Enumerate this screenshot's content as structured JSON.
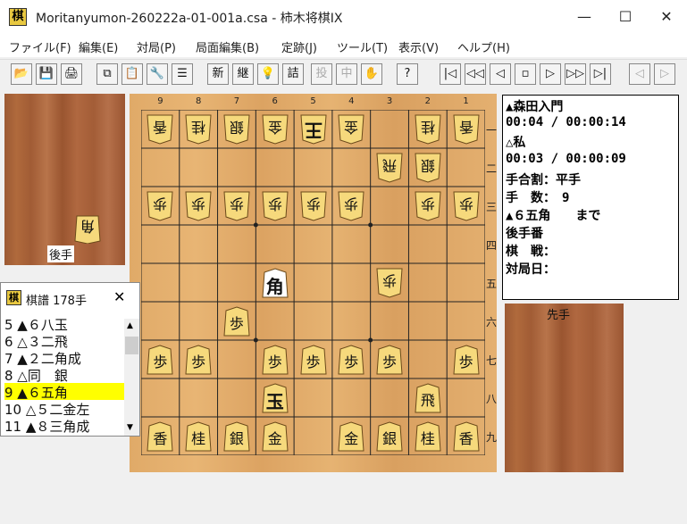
{
  "window": {
    "title": "Moritanyumon-260222a-01-001a.csa - 柿木将棋IX",
    "app_icon": "棋",
    "minimize": "—",
    "maximize": "☐",
    "close": "✕"
  },
  "menu": [
    "ファイル(F)",
    "編集(E)",
    "対局(P)",
    "局面編集(B)",
    "定跡(J)",
    "ツール(T)",
    "表示(V)",
    "ヘルプ(H)"
  ],
  "toolbar": {
    "open": "📂",
    "save": "💾",
    "print": "🖨",
    "copy": "⧉",
    "paste": "📋",
    "settings": "🔧",
    "list": "☰",
    "new_game": "新",
    "continue": "継",
    "hint": "💡",
    "tsume": "詰",
    "resign": "投",
    "pause": "中",
    "hand": "✋",
    "help": "?",
    "first": "|◁",
    "back_fast": "◁◁",
    "back": "◁",
    "stop": "▫",
    "forward": "▷",
    "forward_fast": "▷▷",
    "last": "▷|",
    "branch_prev": "◁",
    "branch_next": "▷"
  },
  "board": {
    "cols": [
      "9",
      "8",
      "7",
      "6",
      "5",
      "4",
      "3",
      "2",
      "1"
    ],
    "rows": [
      "一",
      "二",
      "三",
      "四",
      "五",
      "六",
      "七",
      "八",
      "九"
    ],
    "pieces": [
      {
        "c": 0,
        "r": 0,
        "ch": "香",
        "side": "gote"
      },
      {
        "c": 1,
        "r": 0,
        "ch": "桂",
        "side": "gote"
      },
      {
        "c": 2,
        "r": 0,
        "ch": "銀",
        "side": "gote"
      },
      {
        "c": 3,
        "r": 0,
        "ch": "金",
        "side": "gote"
      },
      {
        "c": 4,
        "r": 0,
        "ch": "王",
        "side": "gote",
        "big": true
      },
      {
        "c": 5,
        "r": 0,
        "ch": "金",
        "side": "gote"
      },
      {
        "c": 7,
        "r": 0,
        "ch": "桂",
        "side": "gote"
      },
      {
        "c": 8,
        "r": 0,
        "ch": "香",
        "side": "gote"
      },
      {
        "c": 6,
        "r": 1,
        "ch": "飛",
        "side": "gote"
      },
      {
        "c": 7,
        "r": 1,
        "ch": "銀",
        "side": "gote"
      },
      {
        "c": 0,
        "r": 2,
        "ch": "歩",
        "side": "gote"
      },
      {
        "c": 1,
        "r": 2,
        "ch": "歩",
        "side": "gote"
      },
      {
        "c": 2,
        "r": 2,
        "ch": "歩",
        "side": "gote"
      },
      {
        "c": 3,
        "r": 2,
        "ch": "歩",
        "side": "gote"
      },
      {
        "c": 4,
        "r": 2,
        "ch": "歩",
        "side": "gote"
      },
      {
        "c": 5,
        "r": 2,
        "ch": "歩",
        "side": "gote"
      },
      {
        "c": 7,
        "r": 2,
        "ch": "歩",
        "side": "gote"
      },
      {
        "c": 8,
        "r": 2,
        "ch": "歩",
        "side": "gote"
      },
      {
        "c": 3,
        "r": 4,
        "ch": "角",
        "side": "sente",
        "big": true,
        "highlight": true
      },
      {
        "c": 6,
        "r": 4,
        "ch": "歩",
        "side": "gote"
      },
      {
        "c": 2,
        "r": 5,
        "ch": "歩",
        "side": "sente"
      },
      {
        "c": 0,
        "r": 6,
        "ch": "歩",
        "side": "sente"
      },
      {
        "c": 1,
        "r": 6,
        "ch": "歩",
        "side": "sente"
      },
      {
        "c": 3,
        "r": 6,
        "ch": "歩",
        "side": "sente"
      },
      {
        "c": 4,
        "r": 6,
        "ch": "歩",
        "side": "sente"
      },
      {
        "c": 5,
        "r": 6,
        "ch": "歩",
        "side": "sente"
      },
      {
        "c": 6,
        "r": 6,
        "ch": "歩",
        "side": "sente"
      },
      {
        "c": 8,
        "r": 6,
        "ch": "歩",
        "side": "sente"
      },
      {
        "c": 3,
        "r": 7,
        "ch": "玉",
        "side": "sente",
        "big": true
      },
      {
        "c": 7,
        "r": 7,
        "ch": "飛",
        "side": "sente"
      },
      {
        "c": 0,
        "r": 8,
        "ch": "香",
        "side": "sente"
      },
      {
        "c": 1,
        "r": 8,
        "ch": "桂",
        "side": "sente"
      },
      {
        "c": 2,
        "r": 8,
        "ch": "銀",
        "side": "sente"
      },
      {
        "c": 3,
        "r": 8,
        "ch": "金",
        "side": "sente"
      },
      {
        "c": 5,
        "r": 8,
        "ch": "金",
        "side": "sente"
      },
      {
        "c": 6,
        "r": 8,
        "ch": "銀",
        "side": "sente"
      },
      {
        "c": 7,
        "r": 8,
        "ch": "桂",
        "side": "sente"
      },
      {
        "c": 8,
        "r": 8,
        "ch": "香",
        "side": "sente"
      }
    ]
  },
  "gote_hand": {
    "label": "後手",
    "pieces": [
      "角"
    ]
  },
  "sente_hand": {
    "label": "先手",
    "pieces": []
  },
  "info": {
    "sente_name": "▲森田入門",
    "sente_time": "00:04 / 00:00:14",
    "gote_name": "△私",
    "gote_time": "00:03 / 00:00:09",
    "handicap": "手合割：平手",
    "move_count": "手　数：　9",
    "last_move": "▲６五角　　まで",
    "turn": "後手番",
    "event": "棋　戦：",
    "date": "対局日："
  },
  "kifu": {
    "icon": "棋",
    "title": "棋譜 178手",
    "close": "✕",
    "selected_index": 4,
    "moves": [
      "5 ▲６八玉",
      "6 △３二飛",
      "7 ▲２二角成",
      "8 △同　銀",
      "9 ▲６五角",
      "10 △５二金左",
      "11 ▲８三角成"
    ]
  }
}
